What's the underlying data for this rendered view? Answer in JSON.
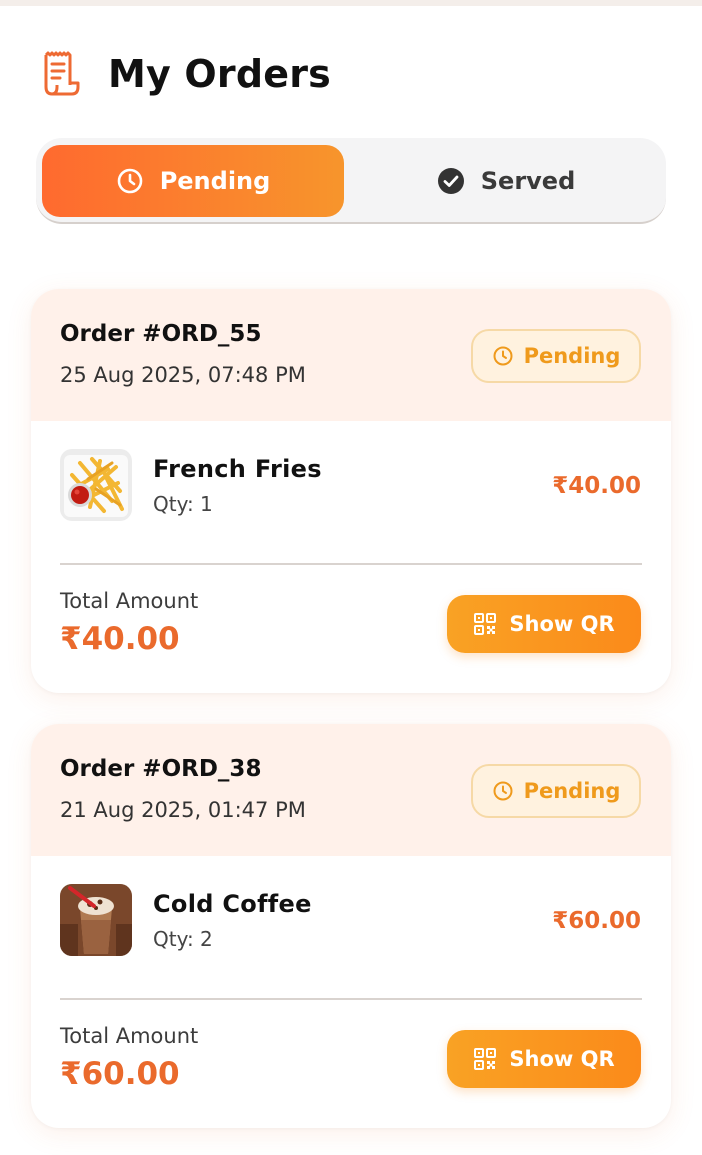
{
  "header": {
    "title": "My Orders",
    "icon": "receipt-icon"
  },
  "tabs": [
    {
      "label": "Pending",
      "icon": "clock-icon",
      "active": true
    },
    {
      "label": "Served",
      "icon": "check-circle-icon",
      "active": false
    }
  ],
  "colors": {
    "accent": "#ea6a2c",
    "badge_text": "#ef9a1c",
    "card_head_bg": "#fff1ea"
  },
  "orders": [
    {
      "id": "Order #ORD_55",
      "date": "25 Aug 2025, 07:48 PM",
      "status": "Pending",
      "items": [
        {
          "name": "French Fries",
          "qty": "Qty: 1",
          "price": "₹40.00",
          "image": "french-fries-image"
        }
      ],
      "total_label": "Total Amount",
      "total": "₹40.00",
      "action_label": "Show QR"
    },
    {
      "id": "Order #ORD_38",
      "date": "21 Aug 2025, 01:47 PM",
      "status": "Pending",
      "items": [
        {
          "name": "Cold Coffee",
          "qty": "Qty: 2",
          "price": "₹60.00",
          "image": "cold-coffee-image"
        }
      ],
      "total_label": "Total Amount",
      "total": "₹60.00",
      "action_label": "Show QR"
    }
  ]
}
